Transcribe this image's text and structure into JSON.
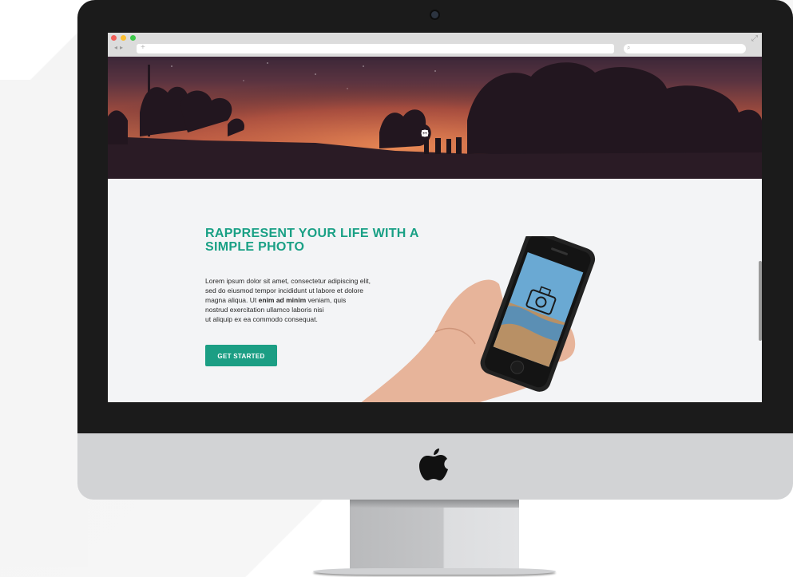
{
  "browser": {
    "url_placeholder": "+",
    "search_placeholder": "",
    "nav_back": "◂",
    "nav_forward": "▸"
  },
  "hero": {
    "social": [
      "twitter-icon",
      "flickr-icon",
      "dribbble-icon"
    ]
  },
  "content": {
    "headline_line1": "RAPPRESENT YOUR LIFE WITH A",
    "headline_line2": "SIMPLE PHOTO",
    "body_line1": "Lorem ipsum dolor sit amet, consectetur adipiscing elit,",
    "body_line2": "sed do eiusmod tempor incididunt ut labore et dolore",
    "body_line3_pre": "magna aliqua. Ut ",
    "body_line3_bold": "enim ad minim",
    "body_line3_post": " veniam, quis",
    "body_line4": "nostrud exercitation ullamco laboris nisi",
    "body_line5": "ut aliquip ex ea commodo consequat.",
    "cta_label": "GET STARTED"
  },
  "colors": {
    "accent": "#19a085",
    "button": "#1b9e84",
    "frame": "#1b1b1b",
    "chin": "#d2d3d5"
  }
}
